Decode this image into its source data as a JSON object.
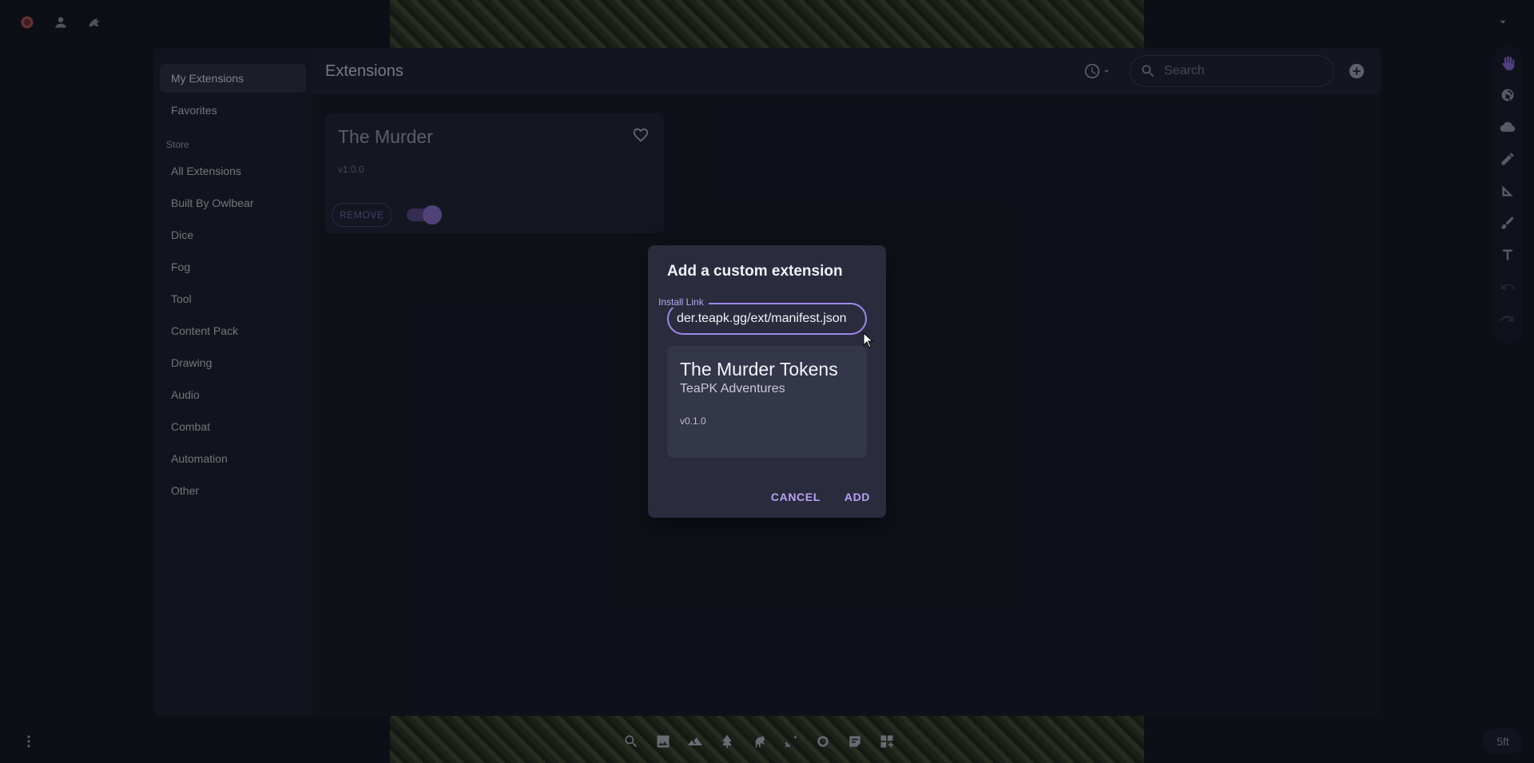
{
  "top_left": {
    "icons": [
      "room-avatar-icon",
      "user-icon",
      "owlbear-logo-icon"
    ]
  },
  "extensions": {
    "header_title": "Extensions",
    "search": {
      "placeholder": "Search",
      "value": ""
    },
    "sidebar": {
      "my_extensions": "My Extensions",
      "favorites": "Favorites",
      "store_heading": "Store",
      "categories": [
        "All Extensions",
        "Built By Owlbear",
        "Dice",
        "Fog",
        "Tool",
        "Content Pack",
        "Drawing",
        "Audio",
        "Combat",
        "Automation",
        "Other"
      ]
    },
    "card": {
      "title": "The Murder",
      "version": "v1.0.0",
      "remove_label": "REMOVE",
      "enabled": true
    }
  },
  "dialog": {
    "title": "Add a custom extension",
    "install_label": "Install Link",
    "install_value": "der.teapk.gg/ext/manifest.json",
    "preview": {
      "name": "The Murder Tokens",
      "author": "TeaPK Adventures",
      "version": "v0.1.0"
    },
    "cancel_label": "CANCEL",
    "add_label": "ADD"
  },
  "scale_label": "5ft",
  "colors": {
    "accent": "#a088e8",
    "background": "#11131c",
    "panel": "#1c1f2c",
    "dialog": "#2a2c3e"
  }
}
